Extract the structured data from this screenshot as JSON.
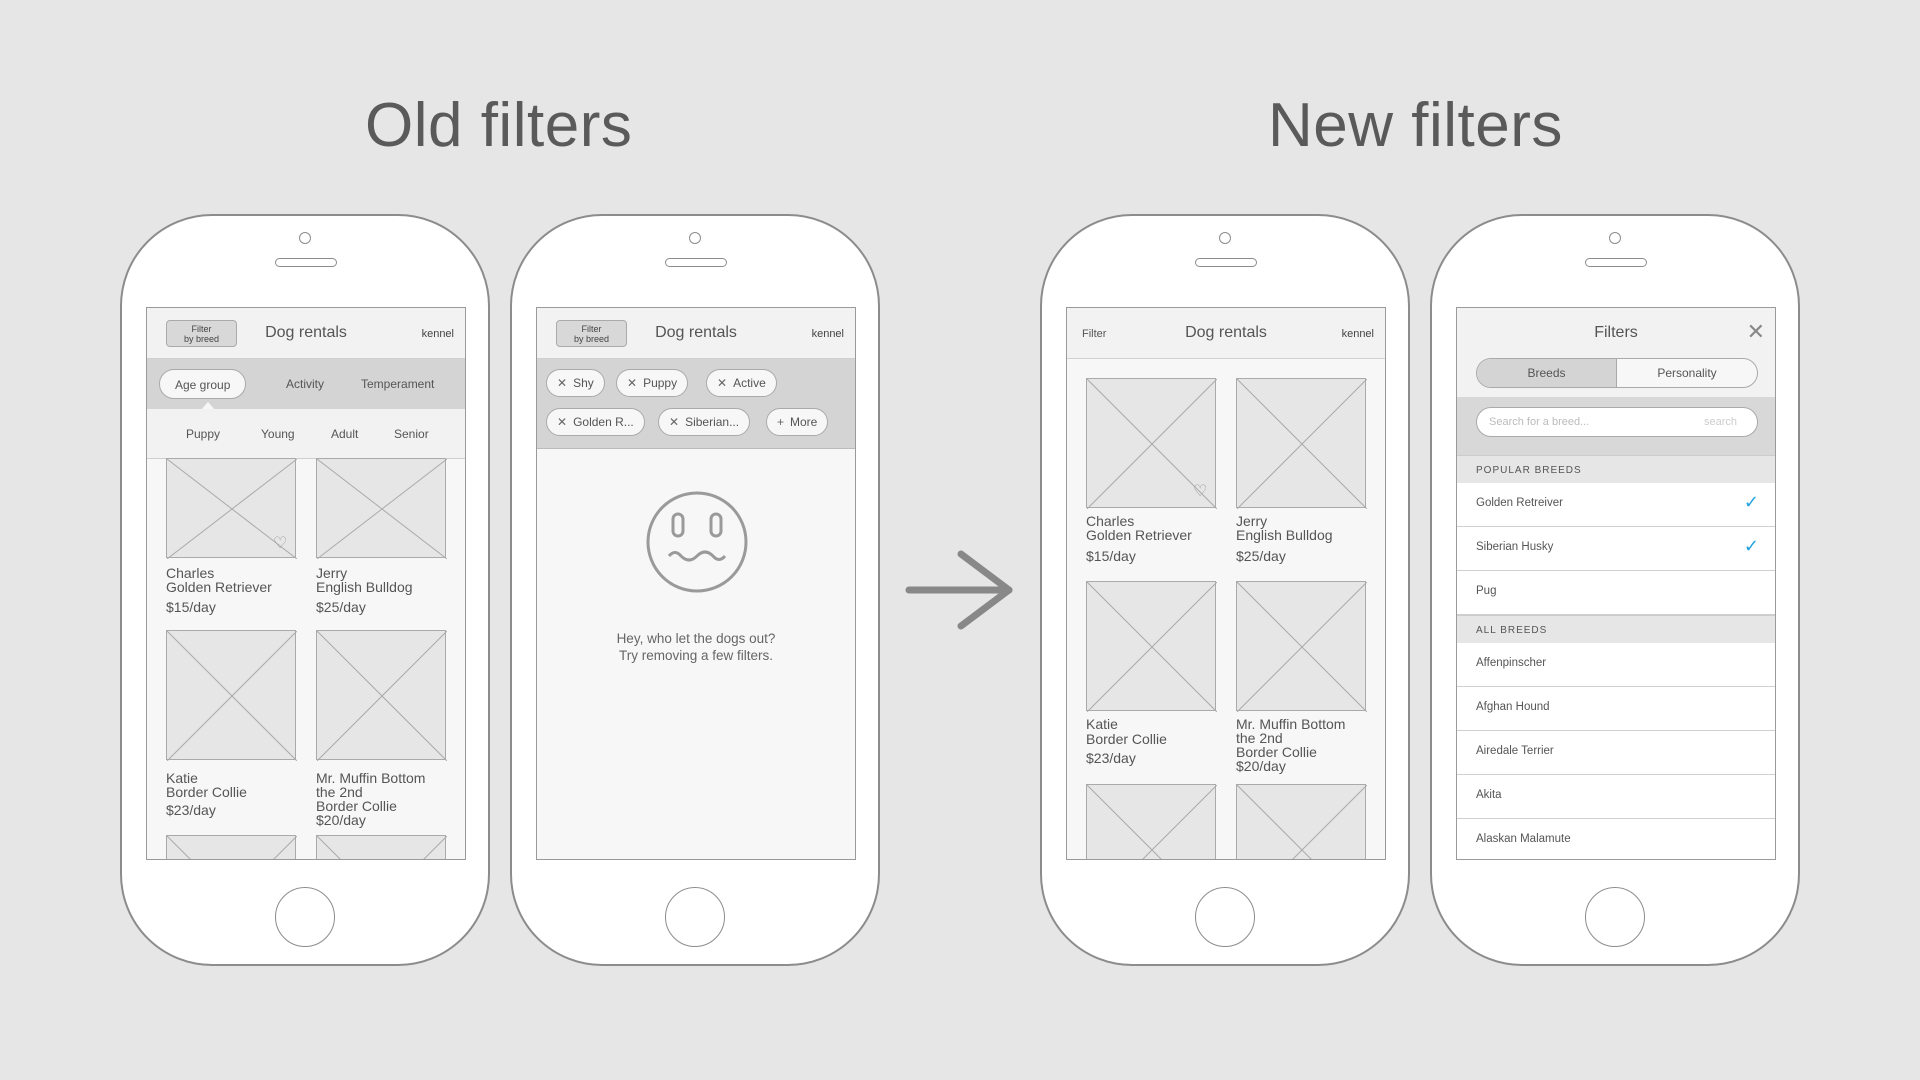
{
  "titles": {
    "old": "Old filters",
    "new": "New filters"
  },
  "app": {
    "title": "Dog rentals",
    "kennel": "kennel",
    "filter_by_breed": [
      "Filter",
      "by breed"
    ],
    "filter": "Filter"
  },
  "old_tabs": [
    "Age group",
    "Activity",
    "Temperament"
  ],
  "age_options": [
    "Puppy",
    "Young",
    "Adult",
    "Senior"
  ],
  "dogs": [
    {
      "name": "Charles",
      "breed": "Golden Retriever",
      "price": "$15/day"
    },
    {
      "name": "Jerry",
      "breed": "English Bulldog",
      "price": "$25/day"
    },
    {
      "name": "Katie",
      "breed": "Border Collie",
      "price": "$23/day"
    },
    {
      "name": "Mr. Muffin Bottom",
      "name2": "the 2nd",
      "breed": "Border Collie",
      "price": "$20/day"
    }
  ],
  "chips": [
    "Shy",
    "Puppy",
    "Active",
    "Golden R...",
    "Siberian...",
    "More"
  ],
  "empty": {
    "line1": "Hey, who let the dogs out?",
    "line2": "Try removing a few filters."
  },
  "filters": {
    "title": "Filters",
    "tabs": [
      "Breeds",
      "Personality"
    ],
    "search_placeholder": "Search for a breed...",
    "search_button": "search",
    "popular_header": "POPULAR BREEDS",
    "popular": [
      {
        "label": "Golden Retreiver",
        "checked": true
      },
      {
        "label": "Siberian Husky",
        "checked": true
      },
      {
        "label": "Pug",
        "checked": false
      }
    ],
    "all_header": "ALL BREEDS",
    "all": [
      "Affenpinscher",
      "Afghan Hound",
      "Airedale Terrier",
      "Akita",
      "Alaskan Malamute"
    ]
  },
  "colors": {
    "background": "#e6e6e6",
    "check": "#22a3dd",
    "frame": "#8c8c8c"
  }
}
